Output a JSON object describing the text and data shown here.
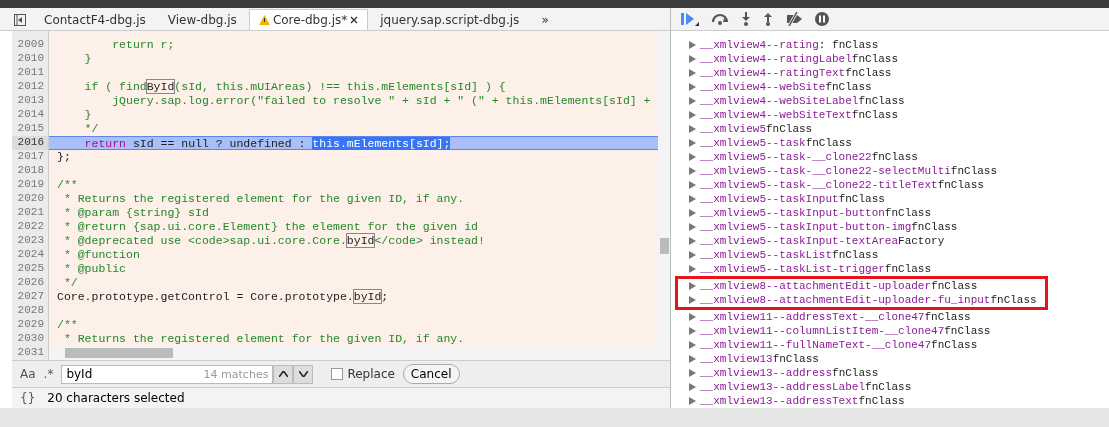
{
  "tabs": [
    {
      "label": "ContactF4-dbg.js",
      "selected": false,
      "warning": false,
      "closable": false
    },
    {
      "label": "View-dbg.js",
      "selected": false,
      "warning": false,
      "closable": false
    },
    {
      "label": "Core-dbg.js*",
      "selected": true,
      "warning": true,
      "closable": true
    },
    {
      "label": "jquery.sap.script-dbg.js",
      "selected": false,
      "warning": false,
      "closable": false
    }
  ],
  "tabs_overflow": "»",
  "editor": {
    "lines": [
      {
        "number": "2009",
        "highlighted": false,
        "segments": [
          {
            "text": "        return r;",
            "kind": "comment"
          }
        ]
      },
      {
        "number": "2010",
        "highlighted": false,
        "segments": [
          {
            "text": "    }",
            "kind": "comment"
          }
        ]
      },
      {
        "number": "2011",
        "highlighted": false
      },
      {
        "number": "2012",
        "highlighted": false,
        "segments": [
          {
            "text": "    if ( find",
            "kind": "comment"
          },
          {
            "text": "ById",
            "kind": "match"
          },
          {
            "text": "(sId, this.mUIAreas) !== this.mElements[sId] ) {",
            "kind": "comment"
          }
        ]
      },
      {
        "number": "2013",
        "highlighted": false,
        "segments": [
          {
            "text": "        jQuery.sap.log.error(\"failed to resolve \" + sId + \" (\" + this.mElements[sId] +",
            "kind": "comment"
          }
        ]
      },
      {
        "number": "2014",
        "highlighted": false,
        "segments": [
          {
            "text": "    }",
            "kind": "comment"
          }
        ]
      },
      {
        "number": "2015",
        "highlighted": false,
        "segments": [
          {
            "text": "    */",
            "kind": "comment"
          }
        ]
      },
      {
        "number": "2016",
        "highlighted": true,
        "segments": [
          {
            "text": "    return",
            "kind": "keyword"
          },
          {
            "text": " sId == null ? undefined : ",
            "kind": "plain"
          },
          {
            "text": "this.mElements[sId];",
            "kind": "selected"
          }
        ]
      },
      {
        "number": "2017",
        "highlighted": false,
        "segments": [
          {
            "text": "};",
            "kind": "plain"
          }
        ]
      },
      {
        "number": "2018",
        "highlighted": false
      },
      {
        "number": "2019",
        "highlighted": false,
        "segments": [
          {
            "text": "/**",
            "kind": "comment"
          }
        ]
      },
      {
        "number": "2020",
        "highlighted": false,
        "segments": [
          {
            "text": " * Returns the registered element for the given ID, if any.",
            "kind": "comment"
          }
        ]
      },
      {
        "number": "2021",
        "highlighted": false,
        "segments": [
          {
            "text": " * @param {string} sId",
            "kind": "comment"
          }
        ]
      },
      {
        "number": "2022",
        "highlighted": false,
        "segments": [
          {
            "text": " * @return {sap.ui.core.Element} the element for the given id",
            "kind": "comment"
          }
        ]
      },
      {
        "number": "2023",
        "highlighted": false,
        "segments": [
          {
            "text": " * @deprecated use <code>sap.ui.core.Core.",
            "kind": "comment"
          },
          {
            "text": "byId",
            "kind": "match"
          },
          {
            "text": "</code> instead!",
            "kind": "comment"
          }
        ]
      },
      {
        "number": "2024",
        "highlighted": false,
        "segments": [
          {
            "text": " * @function",
            "kind": "comment"
          }
        ]
      },
      {
        "number": "2025",
        "highlighted": false,
        "segments": [
          {
            "text": " * @public",
            "kind": "comment"
          }
        ]
      },
      {
        "number": "2026",
        "highlighted": false,
        "segments": [
          {
            "text": " */",
            "kind": "comment"
          }
        ]
      },
      {
        "number": "2027",
        "highlighted": false,
        "segments": [
          {
            "text": "Core.prototype.getControl = Core.prototype.",
            "kind": "plain"
          },
          {
            "text": "byId",
            "kind": "match"
          },
          {
            "text": ";",
            "kind": "plain"
          }
        ]
      },
      {
        "number": "2028",
        "highlighted": false
      },
      {
        "number": "2029",
        "highlighted": false,
        "segments": [
          {
            "text": "/**",
            "kind": "comment"
          }
        ]
      },
      {
        "number": "2030",
        "highlighted": false,
        "segments": [
          {
            "text": " * Returns the registered element for the given ID, if any.",
            "kind": "comment"
          }
        ]
      },
      {
        "number": "2031",
        "highlighted": false
      }
    ]
  },
  "search": {
    "case_label": "Aa",
    "regex_label": ".*",
    "value": "byId",
    "matches": "14 matches",
    "replace": {
      "label": "Replace",
      "checked": false
    },
    "cancel": "Cancel"
  },
  "status_bar": {
    "brace_label": "{}",
    "text": "20 characters selected"
  },
  "scope": {
    "rows": [
      {
        "name": "__xmlview4--rating",
        "separator": ": ",
        "value": "fnClass",
        "highlighted": false
      },
      {
        "name": "__xmlview4--ratingLabel",
        "value": "fnClass",
        "highlighted": false
      },
      {
        "name": "__xmlview4--ratingText",
        "value": "fnClass",
        "highlighted": false
      },
      {
        "name": "__xmlview4--webSite",
        "value": "fnClass",
        "highlighted": false
      },
      {
        "name": "__xmlview4--webSiteLabel",
        "value": "fnClass",
        "highlighted": false
      },
      {
        "name": "__xmlview4--webSiteText",
        "value": "fnClass",
        "highlighted": false
      },
      {
        "name": "__xmlview5",
        "value": "fnClass",
        "highlighted": false
      },
      {
        "name": "__xmlview5--task",
        "value": "fnClass",
        "highlighted": false
      },
      {
        "name": "__xmlview5--task-__clone22",
        "value": "fnClass",
        "highlighted": false
      },
      {
        "name": "__xmlview5--task-__clone22-selectMulti",
        "value": "fnClass",
        "highlighted": false
      },
      {
        "name": "__xmlview5--task-__clone22-titleText",
        "value": "fnClass",
        "highlighted": false
      },
      {
        "name": "__xmlview5--taskInput",
        "value": "fnClass",
        "highlighted": false
      },
      {
        "name": "__xmlview5--taskInput-button",
        "value": "fnClass",
        "highlighted": false
      },
      {
        "name": "__xmlview5--taskInput-button-img",
        "value": "fnClass",
        "highlighted": false
      },
      {
        "name": "__xmlview5--taskInput-textArea",
        "value": "Factory",
        "highlighted": false
      },
      {
        "name": "__xmlview5--taskList",
        "value": "fnClass",
        "highlighted": false
      },
      {
        "name": "__xmlview5--taskList-trigger",
        "value": "fnClass",
        "highlighted": false
      },
      {
        "name": "__xmlview8--attachmentEdit-uploader",
        "value": "fnClass",
        "highlighted": true
      },
      {
        "name": "__xmlview8--attachmentEdit-uploader-fu_input",
        "value": "fnClass",
        "highlighted": true
      },
      {
        "name": "__xmlview11--addressText-__clone47",
        "value": "fnClass",
        "highlighted": false
      },
      {
        "name": "__xmlview11--columnListItem-__clone47",
        "value": "fnClass",
        "highlighted": false
      },
      {
        "name": "__xmlview11--fullNameText-__clone47",
        "value": "fnClass",
        "highlighted": false
      },
      {
        "name": "__xmlview13",
        "value": "fnClass",
        "highlighted": false
      },
      {
        "name": "__xmlview13--address",
        "value": "fnClass",
        "highlighted": false
      },
      {
        "name": "__xmlview13--addressLabel",
        "value": "fnClass",
        "highlighted": false
      },
      {
        "name": "__xmlview13--addressText",
        "value": "fnClass",
        "highlighted": false
      }
    ]
  }
}
